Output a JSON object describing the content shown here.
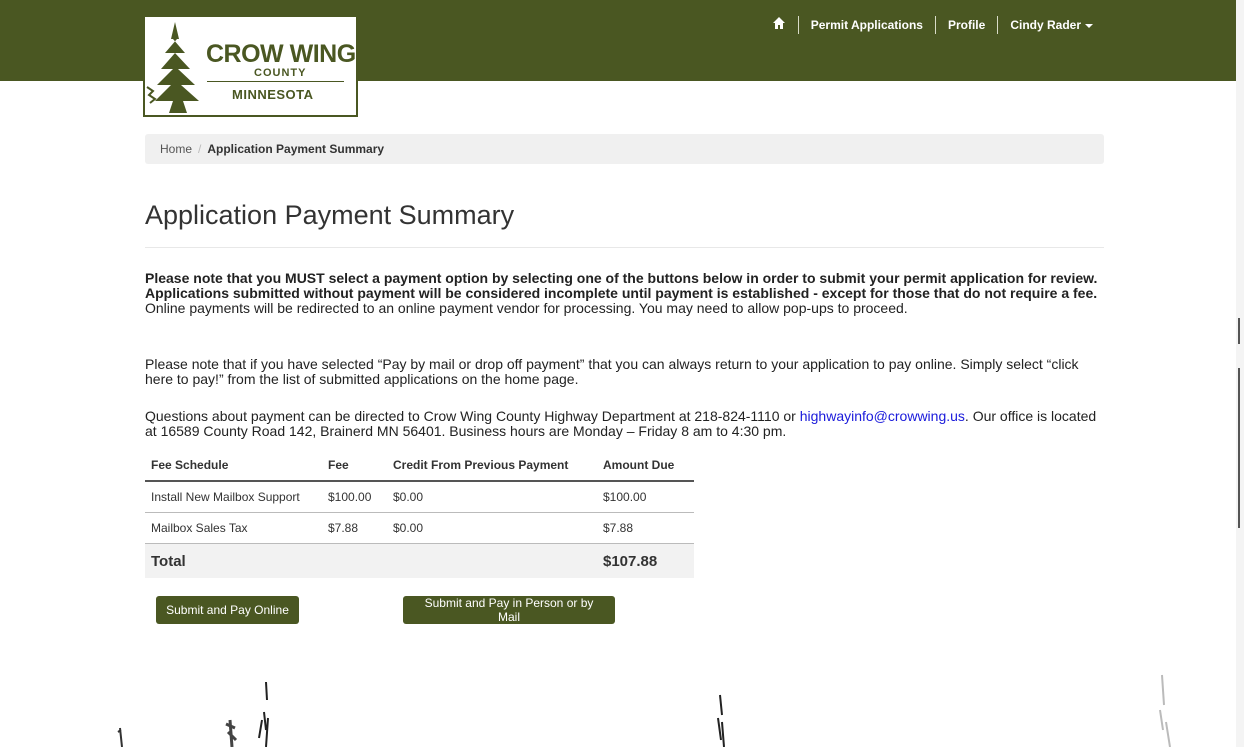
{
  "logo": {
    "line1": "CROW WING",
    "line2": "COUNTY",
    "line3": "MINNESOTA"
  },
  "nav": {
    "home_icon": "home-icon",
    "permit": "Permit Applications",
    "profile": "Profile",
    "user": "Cindy Rader"
  },
  "breadcrumb": {
    "home": "Home",
    "divider": "/",
    "current": "Application Payment Summary"
  },
  "page_title": "Application Payment Summary",
  "notice": {
    "bold": "Please note that you MUST select a payment option by selecting one of the buttons below in order to submit your permit application for review. Applications submitted without payment will be considered incomplete until payment is established - except for those that do not require a fee.",
    "rest": " Online payments will be redirected to an online payment vendor for processing. You may need to allow pop-ups to proceed."
  },
  "mail_note": "Please note that if you have selected “Pay by mail or drop off payment” that you can always return to your application to pay online.  Simply select “click here to pay!” from the list of submitted applications on the home page.",
  "contact": {
    "before": "Questions about payment can be directed to Crow Wing County Highway Department at 218-824-1110 or ",
    "email": "highwayinfo@crowwing.us",
    "after": ".  Our office is located at 16589 County Road 142, Brainerd MN 56401.  Business hours are Monday – Friday 8 am to 4:30  pm."
  },
  "table": {
    "headers": {
      "schedule": "Fee Schedule",
      "fee": "Fee",
      "credit": "Credit From Previous Payment",
      "due": "Amount Due"
    },
    "rows": [
      {
        "schedule": "Install New Mailbox Support",
        "fee": "$100.00",
        "credit": "$0.00",
        "due": "$100.00"
      },
      {
        "schedule": "Mailbox Sales Tax",
        "fee": "$7.88",
        "credit": "$0.00",
        "due": "$7.88"
      }
    ],
    "total_label": "Total",
    "total_value": "$107.88"
  },
  "buttons": {
    "pay_online": "Submit and Pay Online",
    "pay_mail": "Submit and Pay in Person or by Mail"
  },
  "colors": {
    "brand": "#4a5722",
    "link": "#1a1adb"
  }
}
